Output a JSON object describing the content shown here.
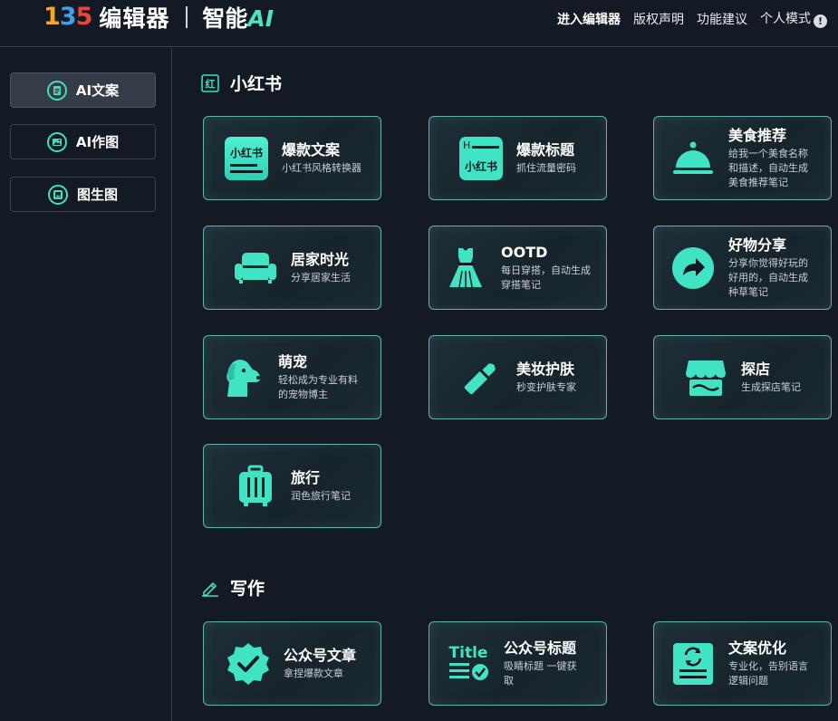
{
  "header": {
    "logo_mark": "135",
    "logo_text": "编辑器",
    "logo_ai_prefix": "智能",
    "logo_ai_suffix": "AI",
    "nav": [
      "进入编辑器",
      "版权声明",
      "功能建议",
      "个人模式"
    ],
    "info_glyph": "!"
  },
  "sidebar": {
    "items": [
      {
        "label": "AI文案",
        "icon": "document-icon",
        "active": true
      },
      {
        "label": "AI作图",
        "icon": "image-icon",
        "active": false
      },
      {
        "label": "图生图",
        "icon": "gallery-icon",
        "active": false
      }
    ]
  },
  "sections": [
    {
      "title": "小红书",
      "icon_text": "红",
      "cards": [
        {
          "title": "爆款文案",
          "desc": [
            "小红书风格转换器"
          ],
          "icon": "xiaohongshu-doc-icon",
          "icon_text": "小红书"
        },
        {
          "title": "爆款标题",
          "desc": [
            "抓住流量密码"
          ],
          "icon": "xiaohongshu-title-icon",
          "icon_text": "小红书"
        },
        {
          "title": "美食推荐",
          "desc": [
            "给我一个美食名称",
            "和描述，自动生成",
            "美食推荐笔记"
          ],
          "icon": "food-cloche-icon"
        },
        {
          "title": "居家时光",
          "desc": [
            "分享居家生活"
          ],
          "icon": "sofa-icon"
        },
        {
          "title": "OOTD",
          "desc": [
            "每日穿搭，自动生成",
            "穿搭笔记"
          ],
          "icon": "dress-icon"
        },
        {
          "title": "好物分享",
          "desc": [
            "分享你觉得好玩的",
            "好用的，自动生成",
            "种草笔记"
          ],
          "icon": "share-arrow-icon"
        },
        {
          "title": "萌宠",
          "desc": [
            "轻松成为专业有料",
            "的宠物博主"
          ],
          "icon": "dog-icon"
        },
        {
          "title": "美妆护肤",
          "desc": [
            "秒变护肤专家"
          ],
          "icon": "lipstick-icon"
        },
        {
          "title": "探店",
          "desc": [
            "生成探店笔记"
          ],
          "icon": "store-icon"
        },
        {
          "title": "旅行",
          "desc": [
            "润色旅行笔记"
          ],
          "icon": "luggage-icon"
        }
      ]
    },
    {
      "title": "写作",
      "icon_text": "",
      "cards": [
        {
          "title": "公众号文章",
          "desc": [
            "拿捏爆款文章"
          ],
          "icon": "verified-badge-icon"
        },
        {
          "title": "公众号标题",
          "desc": [
            "吸睛标题 一键获",
            "取"
          ],
          "icon": "title-check-icon",
          "icon_text": "Title"
        },
        {
          "title": "文案优化",
          "desc": [
            "专业化，告别语言",
            "逻辑问题"
          ],
          "icon": "doc-refresh-icon"
        }
      ]
    }
  ],
  "colors": {
    "background": "#131a23",
    "accent": "#3fe0c0",
    "card_border": "#5fb3b0",
    "divider": "#3a434d",
    "logo_1": "#f5a623",
    "logo_3": "#3ea0e6",
    "logo_5": "#e8453c"
  }
}
